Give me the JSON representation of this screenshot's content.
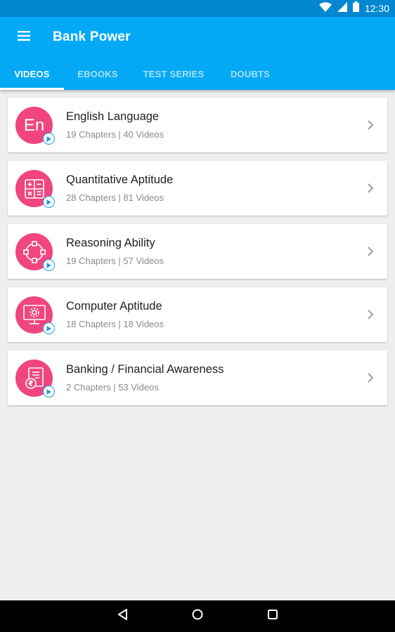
{
  "status_bar": {
    "time": "12:30",
    "icons": [
      "wifi-icon",
      "signal-icon",
      "battery-icon"
    ]
  },
  "app_bar": {
    "title": "Bank Power",
    "menu_icon": "hamburger-menu-icon"
  },
  "tabs": [
    {
      "label": "VIDEOS",
      "active": true
    },
    {
      "label": "EBOOKS",
      "active": false
    },
    {
      "label": "TEST SERIES",
      "active": false
    },
    {
      "label": "DOUBTS",
      "active": false
    }
  ],
  "subjects": [
    {
      "title": "English Language",
      "subtitle": "19 Chapters  |  40 Videos",
      "icon": "english-en-icon",
      "icon_text": "En"
    },
    {
      "title": "Quantitative Aptitude",
      "subtitle": "28 Chapters  |  81 Videos",
      "icon": "calculator-icon"
    },
    {
      "title": "Reasoning Ability",
      "subtitle": "19 Chapters  |  57 Videos",
      "icon": "network-nodes-icon"
    },
    {
      "title": "Computer Aptitude",
      "subtitle": "18 Chapters  |  18 Videos",
      "icon": "computer-gear-icon"
    },
    {
      "title": "Banking / Financial Awareness",
      "subtitle": "2 Chapters  |  53 Videos",
      "icon": "document-rupee-icon"
    }
  ],
  "colors": {
    "primary": "#03a9f4",
    "primary_dark": "#0288d1",
    "accent_pink": "#f0457f",
    "badge_blue": "#1e9be6",
    "background": "#eeeeee"
  },
  "nav": [
    "back-icon",
    "home-icon",
    "recents-icon"
  ]
}
